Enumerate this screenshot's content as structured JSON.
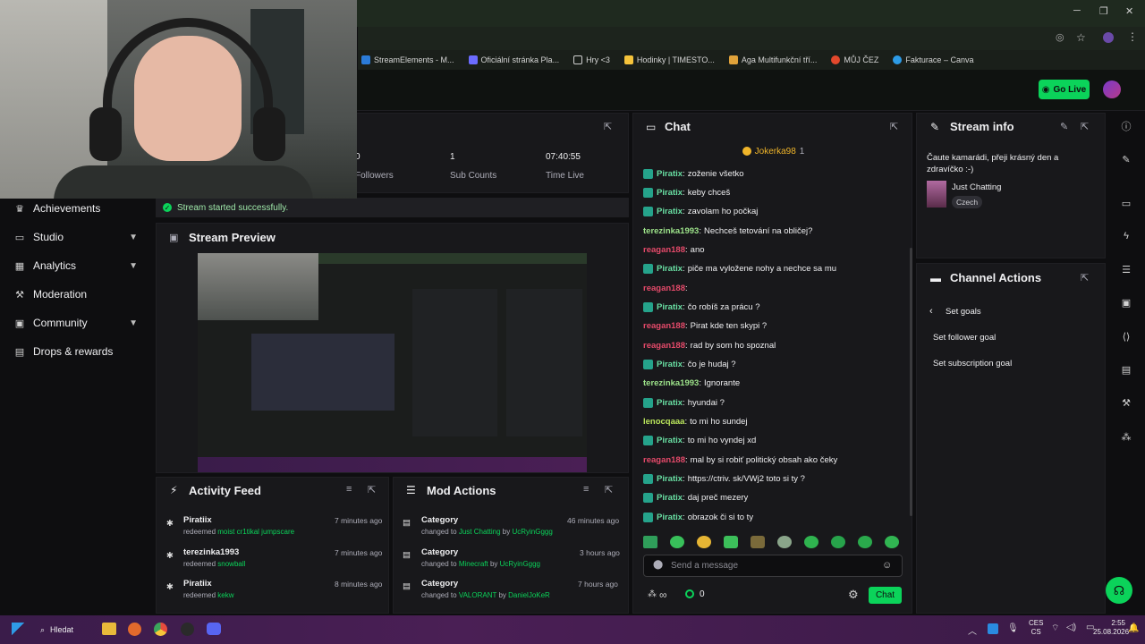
{
  "browser": {
    "bookmarks": [
      {
        "label": "StreamElements - M...",
        "color": "#2b7bd8"
      },
      {
        "label": "Oficiální stránka Pla...",
        "color": "#6b6bff"
      },
      {
        "label": "Hry <3",
        "color": "#cfcfcf"
      },
      {
        "label": "Hodinky | TIMESTO...",
        "color": "#f5c33b"
      },
      {
        "label": "Aga Multifunkční tří...",
        "color": "#e0a23a"
      },
      {
        "label": "MŮJ ČEZ",
        "color": "#e3482c"
      },
      {
        "label": "Fakturace – Canva",
        "color": "#2d9be6"
      }
    ]
  },
  "header": {
    "go_live": "Go Live"
  },
  "sidebar": {
    "items": [
      {
        "label": "Achievements",
        "icon": "trophy-icon"
      },
      {
        "label": "Studio",
        "icon": "monitor-icon"
      },
      {
        "label": "Analytics",
        "icon": "chart-icon"
      },
      {
        "label": "Moderation",
        "icon": "hammer-icon"
      },
      {
        "label": "Community",
        "icon": "chat-icon"
      },
      {
        "label": "Drops & rewards",
        "icon": "gift-icon"
      }
    ]
  },
  "stats": [
    {
      "value": "0",
      "label": "Followers"
    },
    {
      "value": "1",
      "label": "Sub Counts"
    },
    {
      "value": "07:40:55",
      "label": "Time Live"
    }
  ],
  "status": {
    "message": "Stream started successfully."
  },
  "preview": {
    "title": "Stream Preview"
  },
  "chat": {
    "title": "Chat",
    "pinned_user": "Jokerka98",
    "pinned_count": "1",
    "messages": [
      {
        "user": "Piratix",
        "text": "zoženie všetko",
        "style": "u1",
        "badge": true
      },
      {
        "user": "Piratix",
        "text": "keby chceš",
        "style": "u1",
        "badge": true
      },
      {
        "user": "Piratix",
        "text": "zavolam ho počkaj",
        "style": "u1",
        "badge": true
      },
      {
        "user": "terezinka1993",
        "text": "Nechceš tetování na obličej?",
        "style": "u2",
        "badge": false
      },
      {
        "user": "reagan188",
        "text": "ano",
        "style": "u3",
        "badge": false
      },
      {
        "user": "Piratix",
        "text": "piče ma vyložene nohy a nechce sa mu",
        "style": "u1",
        "badge": true
      },
      {
        "user": "reagan188",
        "text": "",
        "style": "u3",
        "badge": false
      },
      {
        "user": "Piratix",
        "text": "čo robíš za prácu ?",
        "style": "u1",
        "badge": true
      },
      {
        "user": "reagan188",
        "text": "Pirat kde ten skypi ?",
        "style": "u3",
        "badge": false
      },
      {
        "user": "reagan188",
        "text": "rad by som ho spoznal",
        "style": "u3",
        "badge": false
      },
      {
        "user": "Piratix",
        "text": "čo je hudaj ?",
        "style": "u1",
        "badge": true
      },
      {
        "user": "terezinka1993",
        "text": "Ignorante",
        "style": "u2",
        "badge": false
      },
      {
        "user": "Piratix",
        "text": "hyundai ?",
        "style": "u1",
        "badge": true
      },
      {
        "user": "lenocqaaa",
        "text": "to mi ho sundej",
        "style": "u4",
        "badge": false
      },
      {
        "user": "Piratix",
        "text": "to mi ho vyndej xd",
        "style": "u1",
        "badge": true
      },
      {
        "user": "reagan188",
        "text": "mal by si robiť politický obsah ako čeky",
        "style": "u3",
        "badge": false
      },
      {
        "user": "Piratix",
        "text": "https://ctriv. sk/VWj2 toto si ty ?",
        "style": "u1",
        "badge": true
      },
      {
        "user": "Piratix",
        "text": "daj preč mezery",
        "style": "u1",
        "badge": true
      },
      {
        "user": "Piratix",
        "text": "obrazok či si to ty",
        "style": "u1",
        "badge": true
      }
    ],
    "input_placeholder": "Send a message",
    "points": "0",
    "send_label": "Chat"
  },
  "stream_info": {
    "title": "Stream info",
    "description": "Čaute kamarádi, přeji krásný den a zdravíčko :-)",
    "category": "Just Chatting",
    "language": "Czech"
  },
  "channel_actions": {
    "title": "Channel Actions",
    "items": [
      "Set goals",
      "Set follower goal",
      "Set subscription goal"
    ]
  },
  "activity_feed": {
    "title": "Activity Feed",
    "items": [
      {
        "name": "Piratiix",
        "action": "redeemed",
        "reward": "moist cr1tikal jumpscare",
        "time": "7 minutes ago"
      },
      {
        "name": "terezinka1993",
        "action": "redeemed",
        "reward": "snowball",
        "time": "7 minutes ago"
      },
      {
        "name": "Piratiix",
        "action": "redeemed",
        "reward": "kekw",
        "time": "8 minutes ago"
      }
    ]
  },
  "mod_actions": {
    "title": "Mod Actions",
    "items": [
      {
        "title": "Category",
        "prefix": "changed to",
        "value": "Just Chatting",
        "by": "by",
        "user": "UcRyinGggg",
        "time": "46 minutes ago"
      },
      {
        "title": "Category",
        "prefix": "changed to",
        "value": "Minecraft",
        "by": "by",
        "user": "UcRyinGggg",
        "time": "3 hours ago"
      },
      {
        "title": "Category",
        "prefix": "changed to",
        "value": "VALORANT",
        "by": "by",
        "user": "DanielJoKeR",
        "time": "7 hours ago"
      }
    ]
  },
  "taskbar": {
    "search": "Hledat",
    "lang": "CES",
    "lang2": "CS",
    "time": "2:55",
    "date": "25.08.2026"
  }
}
